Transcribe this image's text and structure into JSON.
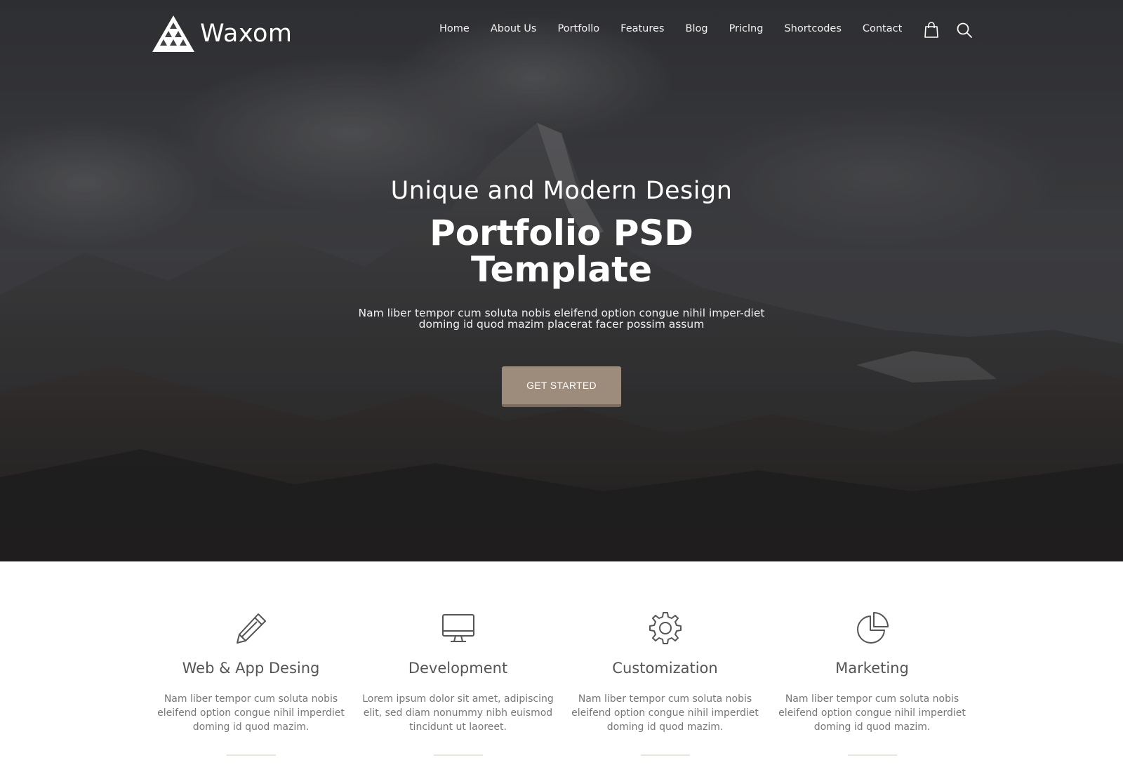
{
  "brand": {
    "name": "Waxom"
  },
  "nav": {
    "items": [
      "Home",
      "About Us",
      "Portfollo",
      "Features",
      "Blog",
      "Priclng",
      "Shortcodes",
      "Contact"
    ],
    "icons": [
      "shopping-bag-icon",
      "search-icon"
    ]
  },
  "hero": {
    "subtitle": "Unique and Modern Design",
    "title_line1": "Portfolio PSD",
    "title_line2": "Template",
    "text": "Nam liber tempor cum soluta nobis eleifend option congue nihil imper-diet doming id quod mazim placerat facer possim assum",
    "cta_label": "GET STARTED"
  },
  "features": [
    {
      "icon": "pencil-icon",
      "title": "Web & App Desing",
      "text": "Nam liber tempor cum soluta nobis eleifend option congue nihil imperdiet doming id quod mazim."
    },
    {
      "icon": "monitor-icon",
      "title": "Development",
      "text": "Lorem ipsum dolor sit amet, adipiscing elit, sed diam nonummy nibh euismod tincidunt ut laoreet."
    },
    {
      "icon": "gear-icon",
      "title": "Customization",
      "text": "Nam liber tempor cum soluta nobis eleifend option congue nihil imperdiet doming id quod mazim."
    },
    {
      "icon": "pie-chart-icon",
      "title": "Marketing",
      "text": "Nam liber tempor cum soluta nobis eleifend option congue nihil imperdiet doming id quod mazim."
    }
  ],
  "colors": {
    "cta_background": "#9d8b7c",
    "hero_overlay": "#2e2f33",
    "divider": "#e9e4dc"
  }
}
